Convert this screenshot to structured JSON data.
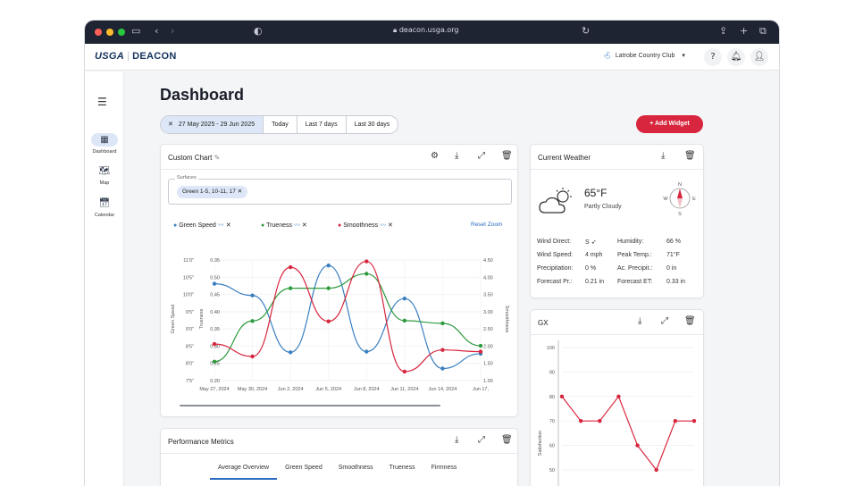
{
  "browser": {
    "url": "deacon.usga.org"
  },
  "app": {
    "logo_left": "USGA",
    "logo_right": "DEACON",
    "club": "Latrobe Country Club",
    "help": "?"
  },
  "sidebar": {
    "items": [
      {
        "label": "Dashboard"
      },
      {
        "label": "Map"
      },
      {
        "label": "Calendar"
      }
    ]
  },
  "page": {
    "title": "Dashboard"
  },
  "date_filter": {
    "range": "27 May 2025 - 29 Jun 2025",
    "options": [
      "Today",
      "Last 7 days",
      "Last 30 days"
    ]
  },
  "add_widget": "+ Add Widget",
  "custom_chart": {
    "title": "Custom Chart",
    "surfaces_label": "Surfaces",
    "chip": "Green 1-5, 10-11, 17",
    "legend": [
      "Green Speed",
      "Trueness",
      "Smoothness"
    ],
    "reset_zoom": "Reset Zoom",
    "axis_left_label": "Green Speed",
    "axis_mid_label": "Trueness",
    "axis_right_label": "Smoothness"
  },
  "chart_data": {
    "type": "line",
    "x": [
      "May 27, 2024",
      "May 30, 2024",
      "Jun 2, 2024",
      "Jun 5, 2024",
      "Jun 8, 2024",
      "Jun 11, 2024",
      "Jun 14, 2024",
      "Jun 17,"
    ],
    "x_ticks": [
      "May 27, 2024",
      "May 30, 2024",
      "Jun 2, 2024",
      "Jun 5, 2024",
      "Jun 8, 2024",
      "Jun 11, 2024",
      "Jun 14, 2024",
      "Jun 17,"
    ],
    "y_left_ticks": [
      "11'0\"",
      "10'5\"",
      "10'0\"",
      "9'5\"",
      "9'0\"",
      "8'5\"",
      "8'0\"",
      "7'5\""
    ],
    "y_mid_ticks": [
      "0.35",
      "0.50",
      "0.45",
      "0.40",
      "0.35",
      "0.30",
      "0.25",
      "0.20"
    ],
    "y_right_ticks": [
      "4.50",
      "4.00",
      "3.50",
      "3.00",
      "2.50",
      "2.00",
      "1.50",
      "1.00"
    ],
    "ylim_right": [
      1.0,
      4.5
    ],
    "series": [
      {
        "name": "Green Speed",
        "color": "#3a7fc1",
        "values": [
          3.81,
          3.47,
          1.82,
          4.34,
          1.84,
          3.38,
          1.35,
          1.78
        ]
      },
      {
        "name": "Trueness",
        "color": "#2e9a3e",
        "values": [
          1.55,
          2.73,
          3.68,
          3.68,
          4.1,
          2.74,
          2.66,
          2.01
        ]
      },
      {
        "name": "Smoothness",
        "color": "#d7263d",
        "values": [
          2.06,
          1.7,
          4.29,
          2.72,
          4.46,
          1.26,
          1.89,
          1.84
        ]
      }
    ]
  },
  "performance": {
    "title": "Performance Metrics",
    "tabs": [
      "Average Overview",
      "Green Speed",
      "Smoothness",
      "Trueness",
      "Firmness"
    ]
  },
  "weather": {
    "title": "Current Weather",
    "temp": "65°F",
    "condition": "Partly Cloudy",
    "compass": {
      "n": "N",
      "e": "E",
      "s": "S",
      "w": "W"
    },
    "rows": [
      {
        "l1": "Wind Direct:",
        "v1": "S ➶",
        "l2": "Humidity:",
        "v2": "66 %"
      },
      {
        "l1": "Wind Speed:",
        "v1": "4 mph",
        "l2": "Peak Temp.:",
        "v2": "71°F"
      },
      {
        "l1": "Precipitation:",
        "v1": "0 %",
        "l2": "Ac. Precipit.:",
        "v2": "0 in"
      },
      {
        "l1": "Forecast Pr.:",
        "v1": "0.21 in",
        "l2": "Forecast ET:",
        "v2": "0.33 in"
      }
    ]
  },
  "gx": {
    "title": "GX",
    "ylabel": "Satisfaction",
    "y_ticks": [
      "100",
      "90",
      "80",
      "70",
      "60",
      "50"
    ],
    "ylim": [
      50,
      100
    ],
    "values": [
      80,
      70,
      70,
      80,
      60,
      50,
      70,
      70
    ],
    "color": "#d7263d"
  }
}
